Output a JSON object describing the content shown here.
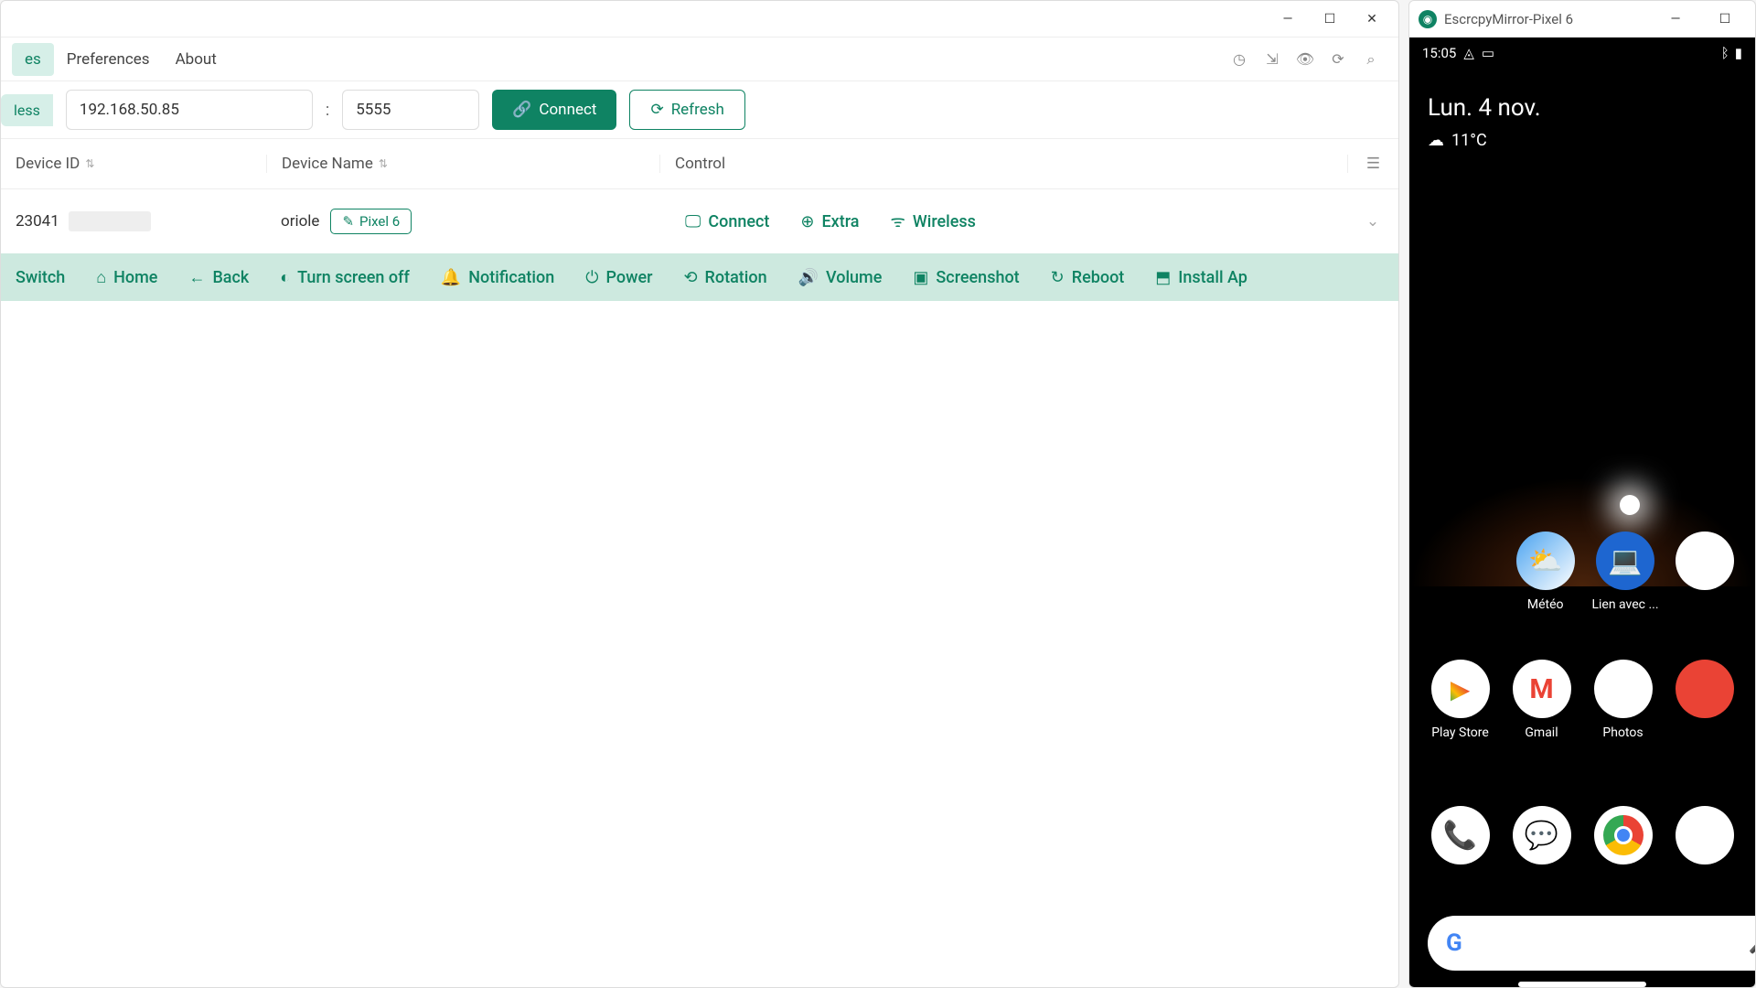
{
  "main": {
    "menu": {
      "devices": "es",
      "preferences": "Preferences",
      "about": "About"
    },
    "chip_less": "less",
    "ip": "192.168.50.85",
    "port": "5555",
    "connect": "Connect",
    "refresh": "Refresh",
    "cols": {
      "id": "Device ID",
      "name": "Device Name",
      "control": "Control"
    },
    "row": {
      "id": "23041",
      "name": "oriole",
      "tag": "Pixel 6",
      "controls": {
        "connect": "Connect",
        "extra": "Extra",
        "wireless": "Wireless"
      }
    },
    "actions": {
      "switch": "Switch",
      "home": "Home",
      "back": "Back",
      "screenoff": "Turn screen off",
      "notification": "Notification",
      "power": "Power",
      "rotation": "Rotation",
      "volume": "Volume",
      "screenshot": "Screenshot",
      "reboot": "Reboot",
      "install": "Install Ap"
    }
  },
  "mirror": {
    "title": "EscrcpyMirror-Pixel 6",
    "status": {
      "time": "15:05"
    },
    "weather": {
      "date": "Lun. 4 nov.",
      "temp": "11°C"
    },
    "apps_row1": [
      {
        "label": "Météo",
        "emoji": "⛅",
        "key": "meteo"
      },
      {
        "label": "Lien avec ...",
        "emoji": "💻",
        "key": "lien"
      }
    ],
    "apps_row2": [
      {
        "label": "Play Store",
        "emoji": "▶",
        "key": "playstore"
      },
      {
        "label": "Gmail",
        "emoji": "M",
        "key": "gmail"
      },
      {
        "label": "Photos",
        "emoji": "✿",
        "key": "photos"
      }
    ],
    "dock": [
      {
        "emoji": "📞",
        "key": "phone"
      },
      {
        "emoji": "💬",
        "key": "messages"
      },
      {
        "emoji": "●",
        "key": "chrome"
      }
    ]
  }
}
